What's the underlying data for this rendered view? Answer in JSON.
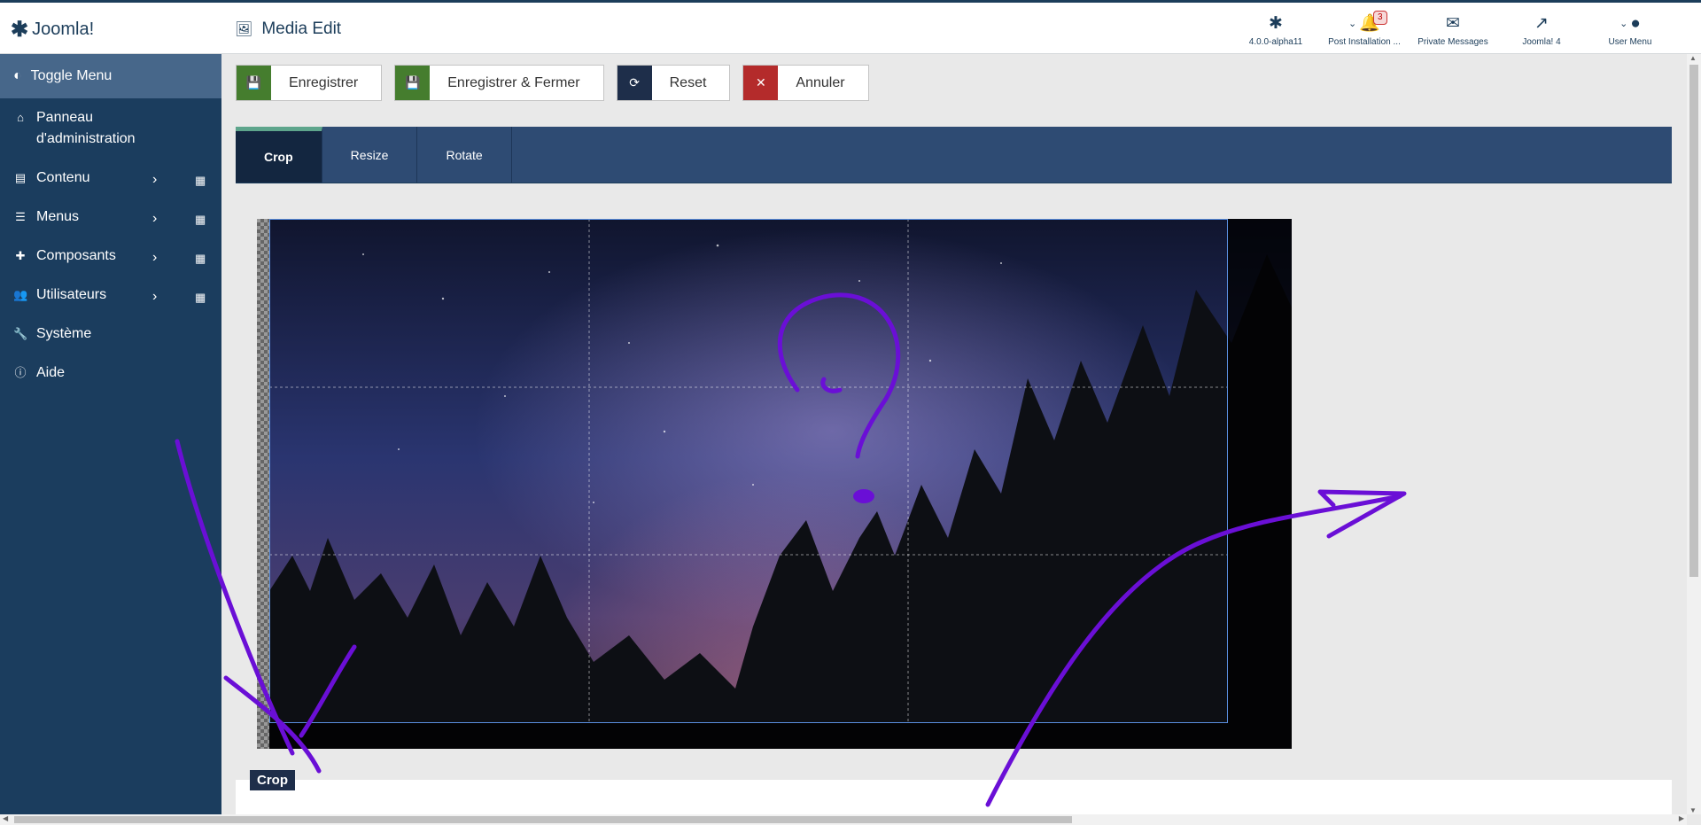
{
  "header": {
    "logo_text": "Joomla!",
    "page_title": "Media Edit",
    "items": [
      {
        "label": "4.0.0-alpha11",
        "icon": "joomla-icon"
      },
      {
        "label": "Post Installation ...",
        "icon": "bell-icon",
        "badge": "3"
      },
      {
        "label": "Private Messages",
        "icon": "envelope-icon"
      },
      {
        "label": "Joomla! 4",
        "icon": "external-link-icon"
      },
      {
        "label": "User Menu",
        "icon": "user-icon"
      }
    ]
  },
  "sidebar": {
    "toggle_label": "Toggle Menu",
    "items": [
      {
        "label": "Panneau",
        "label2": "d'administration",
        "icon": "home-icon"
      },
      {
        "label": "Contenu",
        "icon": "file-icon"
      },
      {
        "label": "Menus",
        "icon": "list-icon"
      },
      {
        "label": "Composants",
        "icon": "puzzle-icon"
      },
      {
        "label": "Utilisateurs",
        "icon": "users-icon"
      },
      {
        "label": "Système",
        "icon": "wrench-icon"
      },
      {
        "label": "Aide",
        "icon": "info-icon"
      }
    ]
  },
  "toolbar": {
    "save_label": "Enregistrer",
    "save_close_label": "Enregistrer & Fermer",
    "reset_label": "Reset",
    "cancel_label": "Annuler"
  },
  "tabs": [
    {
      "label": "Crop",
      "active": true
    },
    {
      "label": "Resize",
      "active": false
    },
    {
      "label": "Rotate",
      "active": false
    }
  ],
  "crop_section_label": "Crop",
  "colors": {
    "sidebar": "#1b3d5e",
    "toolbar_save": "#457d2e",
    "toolbar_reset": "#1e2e4a",
    "toolbar_cancel": "#b42b2b",
    "annotation": "#6a0fd6"
  }
}
